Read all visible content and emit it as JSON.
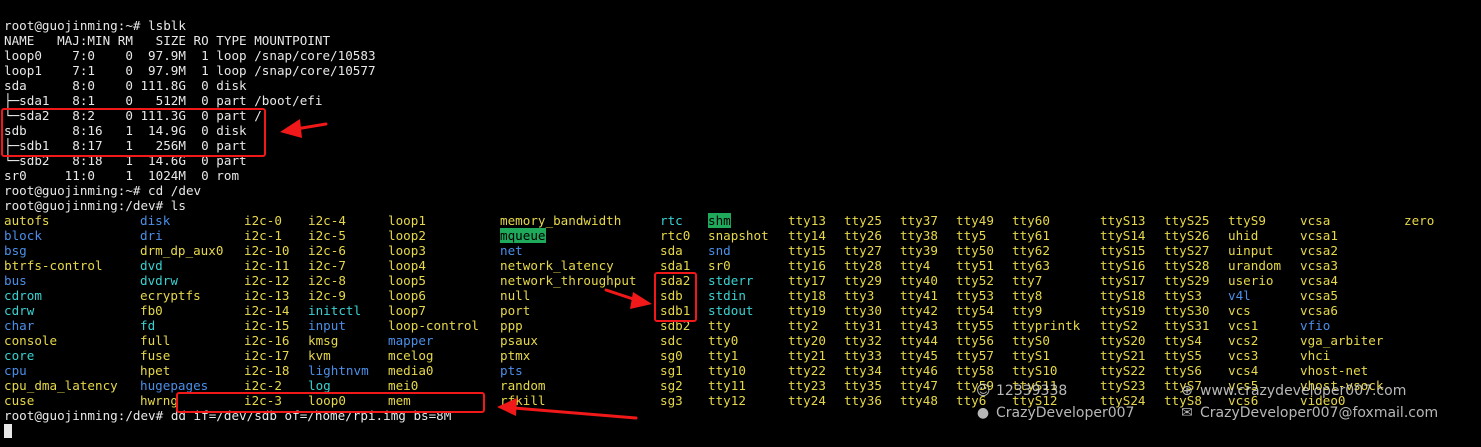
{
  "terminal": {
    "output_lines": [
      "root@guojinming:~# lsblk",
      "NAME   MAJ:MIN RM   SIZE RO TYPE MOUNTPOINT",
      "loop0    7:0    0  97.9M  1 loop /snap/core/10583",
      "loop1    7:1    0  97.9M  1 loop /snap/core/10577",
      "sda      8:0    0 111.8G  0 disk",
      "├─sda1   8:1    0   512M  0 part /boot/efi",
      "└─sda2   8:2    0 111.3G  0 part /",
      "sdb      8:16   1  14.9G  0 disk",
      "├─sdb1   8:17   1   256M  0 part",
      "└─sdb2   8:18   1  14.6G  0 part",
      "sr0     11:0    1  1024M  0 rom",
      "root@guojinming:~# cd /dev",
      "root@guojinming:/dev# ls"
    ],
    "ls_columns": [
      [
        {
          "t": "autofs",
          "c": "dev"
        },
        {
          "t": "block",
          "c": "dir"
        },
        {
          "t": "bsg",
          "c": "dir"
        },
        {
          "t": "btrfs-control",
          "c": "dev"
        },
        {
          "t": "bus",
          "c": "dir"
        },
        {
          "t": "cdrom",
          "c": "link"
        },
        {
          "t": "cdrw",
          "c": "link"
        },
        {
          "t": "char",
          "c": "dir"
        },
        {
          "t": "console",
          "c": "dev"
        },
        {
          "t": "core",
          "c": "link"
        },
        {
          "t": "cpu",
          "c": "dir"
        },
        {
          "t": "cpu_dma_latency",
          "c": "dev"
        },
        {
          "t": "cuse",
          "c": "dev"
        }
      ],
      [
        {
          "t": "disk",
          "c": "dir"
        },
        {
          "t": "dri",
          "c": "dir"
        },
        {
          "t": "drm_dp_aux0",
          "c": "dev"
        },
        {
          "t": "dvd",
          "c": "link"
        },
        {
          "t": "dvdrw",
          "c": "link"
        },
        {
          "t": "ecryptfs",
          "c": "dev"
        },
        {
          "t": "fb0",
          "c": "dev"
        },
        {
          "t": "fd",
          "c": "link"
        },
        {
          "t": "full",
          "c": "dev"
        },
        {
          "t": "fuse",
          "c": "dev"
        },
        {
          "t": "hpet",
          "c": "dev"
        },
        {
          "t": "hugepages",
          "c": "dir"
        },
        {
          "t": "hwrng",
          "c": "dev"
        }
      ],
      [
        {
          "t": "i2c-0",
          "c": "dev"
        },
        {
          "t": "i2c-1",
          "c": "dev"
        },
        {
          "t": "i2c-10",
          "c": "dev"
        },
        {
          "t": "i2c-11",
          "c": "dev"
        },
        {
          "t": "i2c-12",
          "c": "dev"
        },
        {
          "t": "i2c-13",
          "c": "dev"
        },
        {
          "t": "i2c-14",
          "c": "dev"
        },
        {
          "t": "i2c-15",
          "c": "dev"
        },
        {
          "t": "i2c-16",
          "c": "dev"
        },
        {
          "t": "i2c-17",
          "c": "dev"
        },
        {
          "t": "i2c-18",
          "c": "dev"
        },
        {
          "t": "i2c-2",
          "c": "dev"
        },
        {
          "t": "i2c-3",
          "c": "dev"
        }
      ],
      [
        {
          "t": "i2c-4",
          "c": "dev"
        },
        {
          "t": "i2c-5",
          "c": "dev"
        },
        {
          "t": "i2c-6",
          "c": "dev"
        },
        {
          "t": "i2c-7",
          "c": "dev"
        },
        {
          "t": "i2c-8",
          "c": "dev"
        },
        {
          "t": "i2c-9",
          "c": "dev"
        },
        {
          "t": "initctl",
          "c": "link"
        },
        {
          "t": "input",
          "c": "dir"
        },
        {
          "t": "kmsg",
          "c": "dev"
        },
        {
          "t": "kvm",
          "c": "dev"
        },
        {
          "t": "lightnvm",
          "c": "dir"
        },
        {
          "t": "log",
          "c": "link"
        },
        {
          "t": "loop0",
          "c": "dev"
        }
      ],
      [
        {
          "t": "loop1",
          "c": "dev"
        },
        {
          "t": "loop2",
          "c": "dev"
        },
        {
          "t": "loop3",
          "c": "dev"
        },
        {
          "t": "loop4",
          "c": "dev"
        },
        {
          "t": "loop5",
          "c": "dev"
        },
        {
          "t": "loop6",
          "c": "dev"
        },
        {
          "t": "loop7",
          "c": "dev"
        },
        {
          "t": "loop-control",
          "c": "dev"
        },
        {
          "t": "mapper",
          "c": "dir"
        },
        {
          "t": "mcelog",
          "c": "dev"
        },
        {
          "t": "media0",
          "c": "dev"
        },
        {
          "t": "mei0",
          "c": "dev"
        },
        {
          "t": "mem",
          "c": "dev"
        }
      ],
      [
        {
          "t": "memory_bandwidth",
          "c": "dev"
        },
        {
          "t": "mqueue",
          "c": "sticky"
        },
        {
          "t": "net",
          "c": "dir"
        },
        {
          "t": "network_latency",
          "c": "dev"
        },
        {
          "t": "network_throughput",
          "c": "dev"
        },
        {
          "t": "null",
          "c": "dev"
        },
        {
          "t": "port",
          "c": "dev"
        },
        {
          "t": "ppp",
          "c": "dev"
        },
        {
          "t": "psaux",
          "c": "dev"
        },
        {
          "t": "ptmx",
          "c": "dev"
        },
        {
          "t": "pts",
          "c": "dir"
        },
        {
          "t": "random",
          "c": "dev"
        },
        {
          "t": "rfkill",
          "c": "dev"
        }
      ],
      [
        {
          "t": "rtc",
          "c": "link"
        },
        {
          "t": "rtc0",
          "c": "dev"
        },
        {
          "t": "sda",
          "c": "dev"
        },
        {
          "t": "sda1",
          "c": "dev"
        },
        {
          "t": "sda2",
          "c": "dev"
        },
        {
          "t": "sdb",
          "c": "dev"
        },
        {
          "t": "sdb1",
          "c": "dev"
        },
        {
          "t": "sdb2",
          "c": "dev"
        },
        {
          "t": "sdc",
          "c": "dev"
        },
        {
          "t": "sg0",
          "c": "dev"
        },
        {
          "t": "sg1",
          "c": "dev"
        },
        {
          "t": "sg2",
          "c": "dev"
        },
        {
          "t": "sg3",
          "c": "dev"
        }
      ],
      [
        {
          "t": "shm",
          "c": "sticky"
        },
        {
          "t": "snapshot",
          "c": "dev"
        },
        {
          "t": "snd",
          "c": "dir"
        },
        {
          "t": "sr0",
          "c": "dev"
        },
        {
          "t": "stderr",
          "c": "link"
        },
        {
          "t": "stdin",
          "c": "link"
        },
        {
          "t": "stdout",
          "c": "link"
        },
        {
          "t": "tty",
          "c": "dev"
        },
        {
          "t": "tty0",
          "c": "dev"
        },
        {
          "t": "tty1",
          "c": "dev"
        },
        {
          "t": "tty10",
          "c": "dev"
        },
        {
          "t": "tty11",
          "c": "dev"
        },
        {
          "t": "tty12",
          "c": "dev"
        }
      ],
      [
        {
          "t": "tty13",
          "c": "dev"
        },
        {
          "t": "tty14",
          "c": "dev"
        },
        {
          "t": "tty15",
          "c": "dev"
        },
        {
          "t": "tty16",
          "c": "dev"
        },
        {
          "t": "tty17",
          "c": "dev"
        },
        {
          "t": "tty18",
          "c": "dev"
        },
        {
          "t": "tty19",
          "c": "dev"
        },
        {
          "t": "tty2",
          "c": "dev"
        },
        {
          "t": "tty20",
          "c": "dev"
        },
        {
          "t": "tty21",
          "c": "dev"
        },
        {
          "t": "tty22",
          "c": "dev"
        },
        {
          "t": "tty23",
          "c": "dev"
        },
        {
          "t": "tty24",
          "c": "dev"
        }
      ],
      [
        {
          "t": "tty25",
          "c": "dev"
        },
        {
          "t": "tty26",
          "c": "dev"
        },
        {
          "t": "tty27",
          "c": "dev"
        },
        {
          "t": "tty28",
          "c": "dev"
        },
        {
          "t": "tty29",
          "c": "dev"
        },
        {
          "t": "tty3",
          "c": "dev"
        },
        {
          "t": "tty30",
          "c": "dev"
        },
        {
          "t": "tty31",
          "c": "dev"
        },
        {
          "t": "tty32",
          "c": "dev"
        },
        {
          "t": "tty33",
          "c": "dev"
        },
        {
          "t": "tty34",
          "c": "dev"
        },
        {
          "t": "tty35",
          "c": "dev"
        },
        {
          "t": "tty36",
          "c": "dev"
        }
      ],
      [
        {
          "t": "tty37",
          "c": "dev"
        },
        {
          "t": "tty38",
          "c": "dev"
        },
        {
          "t": "tty39",
          "c": "dev"
        },
        {
          "t": "tty4",
          "c": "dev"
        },
        {
          "t": "tty40",
          "c": "dev"
        },
        {
          "t": "tty41",
          "c": "dev"
        },
        {
          "t": "tty42",
          "c": "dev"
        },
        {
          "t": "tty43",
          "c": "dev"
        },
        {
          "t": "tty44",
          "c": "dev"
        },
        {
          "t": "tty45",
          "c": "dev"
        },
        {
          "t": "tty46",
          "c": "dev"
        },
        {
          "t": "tty47",
          "c": "dev"
        },
        {
          "t": "tty48",
          "c": "dev"
        }
      ],
      [
        {
          "t": "tty49",
          "c": "dev"
        },
        {
          "t": "tty5",
          "c": "dev"
        },
        {
          "t": "tty50",
          "c": "dev"
        },
        {
          "t": "tty51",
          "c": "dev"
        },
        {
          "t": "tty52",
          "c": "dev"
        },
        {
          "t": "tty53",
          "c": "dev"
        },
        {
          "t": "tty54",
          "c": "dev"
        },
        {
          "t": "tty55",
          "c": "dev"
        },
        {
          "t": "tty56",
          "c": "dev"
        },
        {
          "t": "tty57",
          "c": "dev"
        },
        {
          "t": "tty58",
          "c": "dev"
        },
        {
          "t": "tty59",
          "c": "dev"
        },
        {
          "t": "tty6",
          "c": "dev"
        }
      ],
      [
        {
          "t": "tty60",
          "c": "dev"
        },
        {
          "t": "tty61",
          "c": "dev"
        },
        {
          "t": "tty62",
          "c": "dev"
        },
        {
          "t": "tty63",
          "c": "dev"
        },
        {
          "t": "tty7",
          "c": "dev"
        },
        {
          "t": "tty8",
          "c": "dev"
        },
        {
          "t": "tty9",
          "c": "dev"
        },
        {
          "t": "ttyprintk",
          "c": "dev"
        },
        {
          "t": "ttyS0",
          "c": "dev"
        },
        {
          "t": "ttyS1",
          "c": "dev"
        },
        {
          "t": "ttyS10",
          "c": "dev"
        },
        {
          "t": "ttyS11",
          "c": "dev"
        },
        {
          "t": "ttyS12",
          "c": "dev"
        }
      ],
      [
        {
          "t": "ttyS13",
          "c": "dev"
        },
        {
          "t": "ttyS14",
          "c": "dev"
        },
        {
          "t": "ttyS15",
          "c": "dev"
        },
        {
          "t": "ttyS16",
          "c": "dev"
        },
        {
          "t": "ttyS17",
          "c": "dev"
        },
        {
          "t": "ttyS18",
          "c": "dev"
        },
        {
          "t": "ttyS19",
          "c": "dev"
        },
        {
          "t": "ttyS2",
          "c": "dev"
        },
        {
          "t": "ttyS20",
          "c": "dev"
        },
        {
          "t": "ttyS21",
          "c": "dev"
        },
        {
          "t": "ttyS22",
          "c": "dev"
        },
        {
          "t": "ttyS23",
          "c": "dev"
        },
        {
          "t": "ttyS24",
          "c": "dev"
        }
      ],
      [
        {
          "t": "ttyS25",
          "c": "dev"
        },
        {
          "t": "ttyS26",
          "c": "dev"
        },
        {
          "t": "ttyS27",
          "c": "dev"
        },
        {
          "t": "ttyS28",
          "c": "dev"
        },
        {
          "t": "ttyS29",
          "c": "dev"
        },
        {
          "t": "ttyS3",
          "c": "dev"
        },
        {
          "t": "ttyS30",
          "c": "dev"
        },
        {
          "t": "ttyS31",
          "c": "dev"
        },
        {
          "t": "ttyS4",
          "c": "dev"
        },
        {
          "t": "ttyS5",
          "c": "dev"
        },
        {
          "t": "ttyS6",
          "c": "dev"
        },
        {
          "t": "ttyS7",
          "c": "dev"
        },
        {
          "t": "ttyS8",
          "c": "dev"
        }
      ],
      [
        {
          "t": "ttyS9",
          "c": "dev"
        },
        {
          "t": "uhid",
          "c": "dev"
        },
        {
          "t": "uinput",
          "c": "dev"
        },
        {
          "t": "urandom",
          "c": "dev"
        },
        {
          "t": "userio",
          "c": "dev"
        },
        {
          "t": "v4l",
          "c": "dir"
        },
        {
          "t": "vcs",
          "c": "dev"
        },
        {
          "t": "vcs1",
          "c": "dev"
        },
        {
          "t": "vcs2",
          "c": "dev"
        },
        {
          "t": "vcs3",
          "c": "dev"
        },
        {
          "t": "vcs4",
          "c": "dev"
        },
        {
          "t": "vcs5",
          "c": "dev"
        },
        {
          "t": "vcs6",
          "c": "dev"
        }
      ],
      [
        {
          "t": "vcsa",
          "c": "dev"
        },
        {
          "t": "vcsa1",
          "c": "dev"
        },
        {
          "t": "vcsa2",
          "c": "dev"
        },
        {
          "t": "vcsa3",
          "c": "dev"
        },
        {
          "t": "vcsa4",
          "c": "dev"
        },
        {
          "t": "vcsa5",
          "c": "dev"
        },
        {
          "t": "vcsa6",
          "c": "dev"
        },
        {
          "t": "vfio",
          "c": "dir"
        },
        {
          "t": "vga_arbiter",
          "c": "dev"
        },
        {
          "t": "vhci",
          "c": "dev"
        },
        {
          "t": "vhost-net",
          "c": "dev"
        },
        {
          "t": "vhost-vsock",
          "c": "dev"
        },
        {
          "t": "video0",
          "c": "dev"
        }
      ],
      [
        {
          "t": "zero",
          "c": "dev"
        }
      ]
    ],
    "final_prompt": "root@guojinming:/dev# ",
    "final_command": "dd if=/dev/sdb of=/home/rpi.img bs=8M"
  },
  "watermark": {
    "id_text": "12339338",
    "author": "CrazyDeveloper007",
    "site": "www.crazydeveloper007.com",
    "email": "CrazyDeveloper007@foxmail.com"
  },
  "colors": {
    "background": "#000000",
    "text": "#e8e8e8",
    "directory": "#4b8ee8",
    "device": "#e6d84a",
    "symlink": "#3ad1d1",
    "sticky_bg": "#1fa95a",
    "annotation_red": "#f01818"
  }
}
